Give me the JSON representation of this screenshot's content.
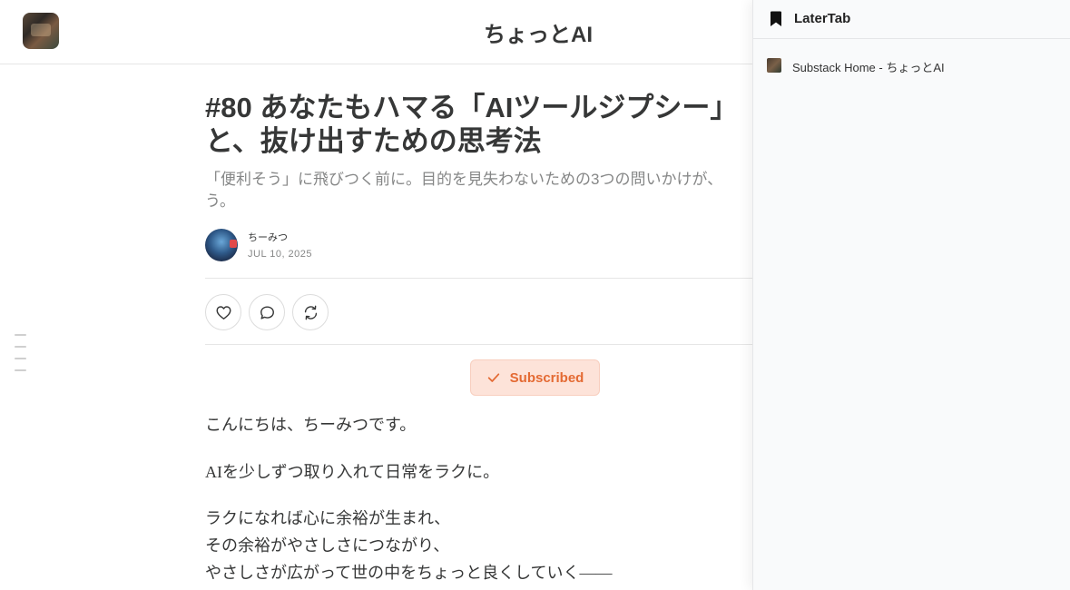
{
  "site": {
    "title": "ちょっとAI"
  },
  "article": {
    "headline_line1": "#80 あなたもハマる「AIツールジプシー」",
    "headline_line2": "と、抜け出すための思考法",
    "subtitle_line1": "「便利そう」に飛びつく前に。目的を見失わないための3つの問いかけが、",
    "subtitle_line2": "う。",
    "author": "ちーみつ",
    "date": "JUL 10, 2025",
    "subscribe_label": "Subscribed",
    "paragraphs": {
      "p1": "こんにちは、ちーみつです。",
      "p2": "AIを少しずつ取り入れて日常をラクに。",
      "p3_line1": "ラクになれば心に余裕が生まれ、",
      "p3_line2": "その余裕がやさしさにつながり、",
      "p3_line3": "やさしさが広がって世の中をちょっと良くしていく——"
    }
  },
  "actions": {
    "like_icon": "heart-icon",
    "comment_icon": "comment-icon",
    "restack_icon": "restack-icon"
  },
  "panel": {
    "title": "LaterTab",
    "icon": "bookmark-icon",
    "items": [
      {
        "title": "Substack Home - ちょっとAI"
      }
    ]
  },
  "colors": {
    "accent": "#e46a33",
    "subscribed_bg": "#fde3d9",
    "text": "#363737",
    "muted": "#868787"
  }
}
